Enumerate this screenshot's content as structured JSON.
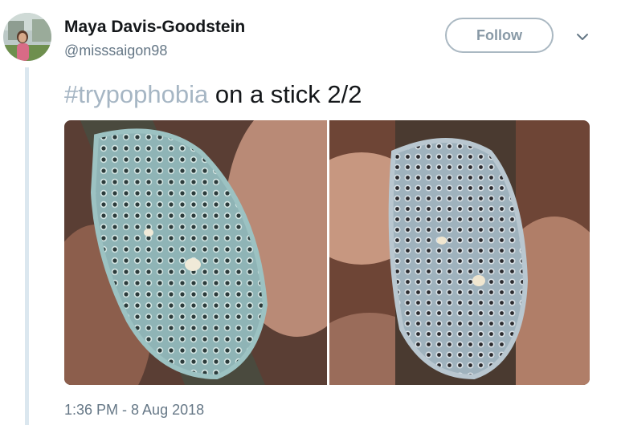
{
  "author": {
    "display_name": "Maya Davis-Goodstein",
    "handle": "@misssaigon98"
  },
  "follow_button": {
    "label": "Follow"
  },
  "tweet": {
    "hashtag": "#trypophobia",
    "text": " on a stick 2/2",
    "timestamp": "1:36 PM - 8 Aug 2018"
  },
  "icons": {
    "menu": "chevron-down-icon"
  },
  "colors": {
    "name": "#14171a",
    "secondary": "#657786",
    "hashtag": "#a6b6c4",
    "follow_border": "#aab8c2",
    "thread_line": "#dbe7ef"
  }
}
